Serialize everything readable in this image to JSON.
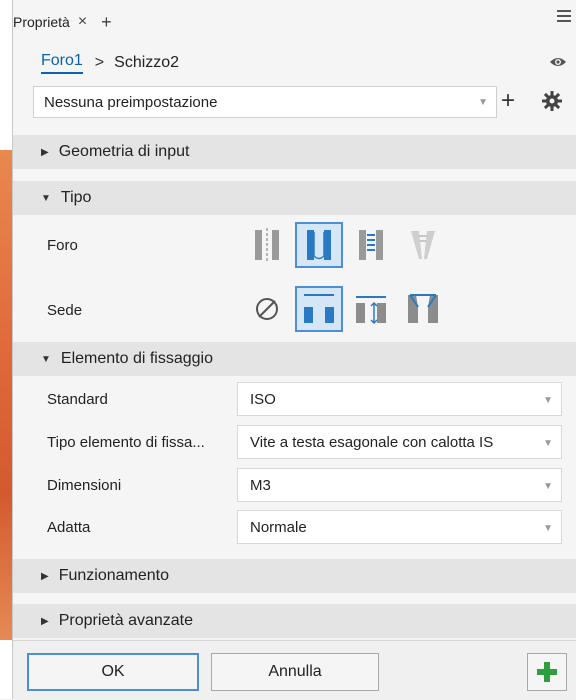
{
  "panel": {
    "tab_label": "Proprietà",
    "close_glyph": "×",
    "add_tab_glyph": "+"
  },
  "breadcrumb": {
    "item1": "Foro1",
    "separator": ">",
    "item2": "Schizzo2"
  },
  "preset": {
    "value": "Nessuna preimpostazione",
    "add_glyph": "+"
  },
  "sections": {
    "geometry": "Geometria di input",
    "type": "Tipo",
    "fastener": "Elemento di fissaggio",
    "behavior": "Funzionamento",
    "advanced": "Proprietà avanzate"
  },
  "type": {
    "hole_label": "Foro",
    "seat_label": "Sede",
    "hole_options": [
      "simple-hole-icon",
      "clearance-hole-icon",
      "tapped-hole-icon",
      "taper-tapped-hole-icon"
    ],
    "hole_selected": 1,
    "seat_options": [
      "none-icon",
      "counterbore-icon",
      "spotface-icon",
      "countersink-icon"
    ],
    "seat_selected": 1
  },
  "fastener": {
    "standard_label": "Standard",
    "standard_value": "ISO",
    "type_label": "Tipo elemento di fissa...",
    "type_value": "Vite a testa esagonale con calotta IS",
    "size_label": "Dimensioni",
    "size_value": "M3",
    "fit_label": "Adatta",
    "fit_value": "Normale"
  },
  "footer": {
    "ok": "OK",
    "cancel": "Annulla"
  },
  "colors": {
    "accent": "#0b63ae",
    "selection_border": "#4a90d9",
    "selection_fill": "#d5e6f7",
    "plus_green": "#2e9e3e"
  }
}
